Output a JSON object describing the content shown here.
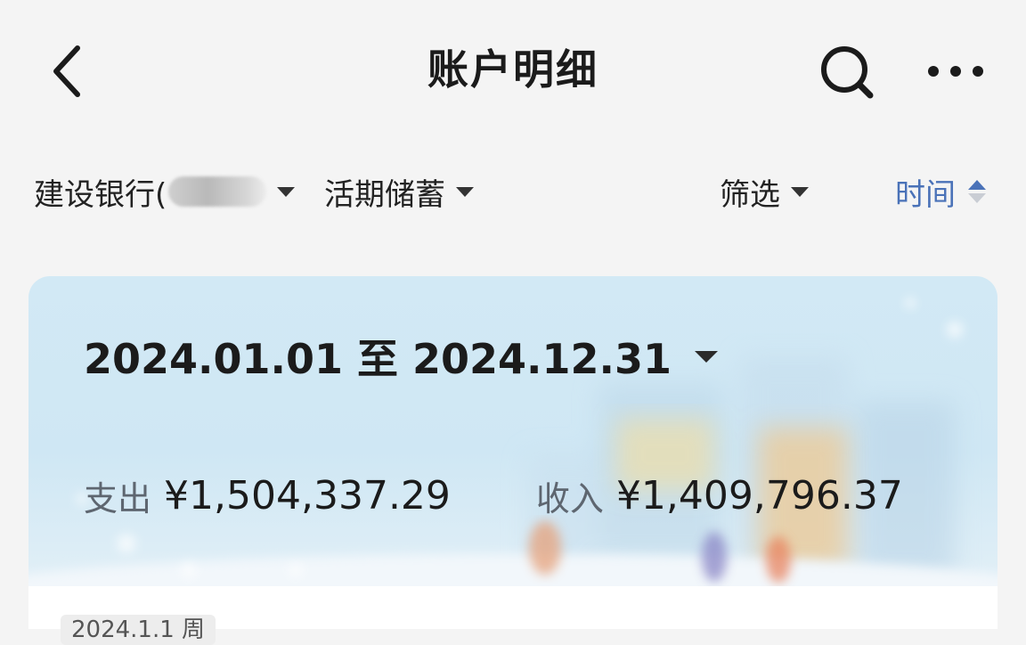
{
  "header": {
    "title": "账户明细",
    "back_icon": "chevron-left-icon",
    "search_icon": "search-icon",
    "more_icon": "more-horizontal-icon"
  },
  "filters": {
    "account": "建设银行(",
    "account_type": "活期储蓄",
    "filter": "筛选",
    "sort": "时间"
  },
  "summary": {
    "date_range": "2024.01.01 至 2024.12.31",
    "expense_label": "支出",
    "expense_value": "¥1,504,337.29",
    "income_label": "收入",
    "income_value": "¥1,409,796.37"
  },
  "list": {
    "first_date_chip": "2024.1.1 周"
  },
  "colors": {
    "accent": "#4a72b8",
    "background": "#f4f4f4",
    "card": "#d2e9f5"
  }
}
